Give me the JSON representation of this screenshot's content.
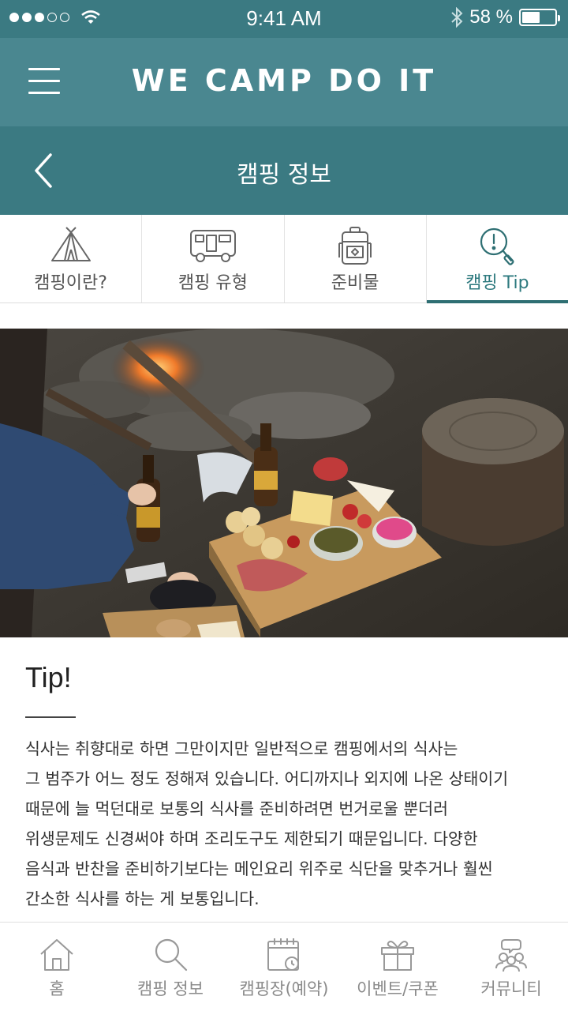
{
  "status_bar": {
    "time": "9:41 AM",
    "battery": "58 %",
    "battery_level": 0.58,
    "signal_dots_filled": 3,
    "signal_dots_total": 5
  },
  "app": {
    "title": "WE CAMP DO IT"
  },
  "sub_header": {
    "title": "캠핑 정보"
  },
  "tabs": [
    {
      "label": "캠핑이란?",
      "icon": "tent-icon"
    },
    {
      "label": "캠핑 유형",
      "icon": "camper-van-icon"
    },
    {
      "label": "준비물",
      "icon": "backpack-icon"
    },
    {
      "label": "캠핑 Tip",
      "icon": "tip-search-icon",
      "active": true
    }
  ],
  "content": {
    "heading": "Tip!",
    "lines": [
      "식사는 취향대로 하면 그만이지만 일반적으로 캠핑에서의 식사는",
      "그 범주가 어느 정도 정해져 있습니다. 어디까지나 외지에 나온 상태이기",
      "때문에 늘 먹던대로 보통의 식사를 준비하려면 번거로울 뿐더러",
      "위생문제도 신경써야 하며 조리도구도 제한되기 때문입니다. 다양한",
      "음식과 반찬을 준비하기보다는 메인요리 위주로 식단을 맞추거나 훨씬",
      "간소한 식사를 하는 게 보통입니다."
    ]
  },
  "bottom_nav": [
    {
      "label": "홈",
      "icon": "home-icon"
    },
    {
      "label": "캠핑 정보",
      "icon": "search-icon"
    },
    {
      "label": "캠핑장(예약)",
      "icon": "calendar-icon"
    },
    {
      "label": "이벤트/쿠폰",
      "icon": "gift-icon"
    },
    {
      "label": "커뮤니티",
      "icon": "community-icon"
    }
  ],
  "colors": {
    "primary": "#3b7a82",
    "header": "#4a8790",
    "active_tab": "#2e7a7f"
  }
}
